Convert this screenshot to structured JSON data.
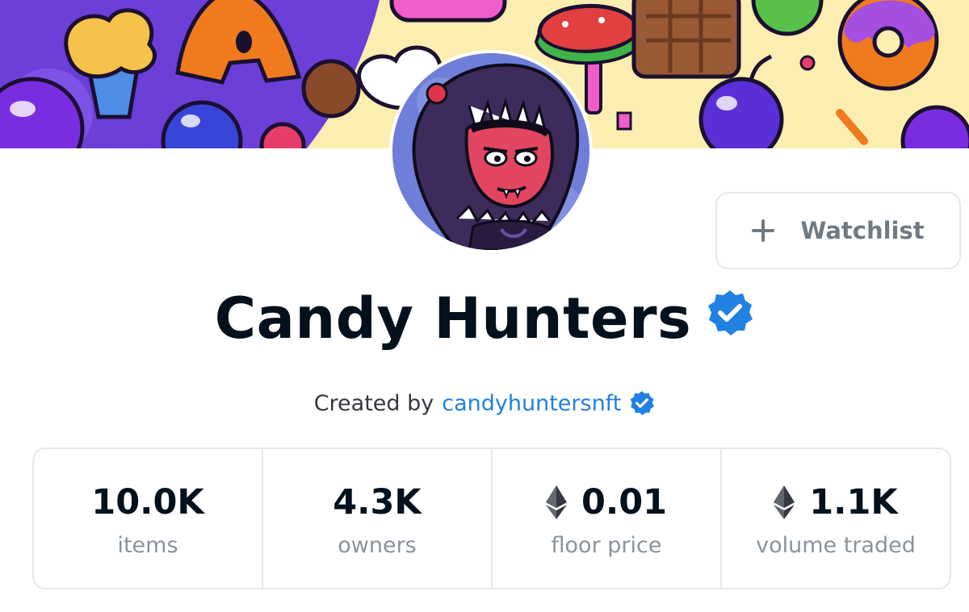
{
  "watchlist": {
    "label": "Watchlist"
  },
  "collection": {
    "title": "Candy Hunters",
    "verified": true,
    "created_by_prefix": "Created by",
    "creator": "candyhuntersnft",
    "creator_verified": true
  },
  "stats": [
    {
      "value": "10.0K",
      "label": "items",
      "icon": null
    },
    {
      "value": "4.3K",
      "label": "owners",
      "icon": null
    },
    {
      "value": "0.01",
      "label": "floor price",
      "icon": "ethereum-icon"
    },
    {
      "value": "1.1K",
      "label": "volume traded",
      "icon": "ethereum-icon"
    }
  ],
  "colors": {
    "accent_blue": "#2081e2",
    "text_primary": "#04111d",
    "text_secondary": "#8a939b",
    "border": "#e5e8eb",
    "verified_badge": "#2081e2"
  }
}
